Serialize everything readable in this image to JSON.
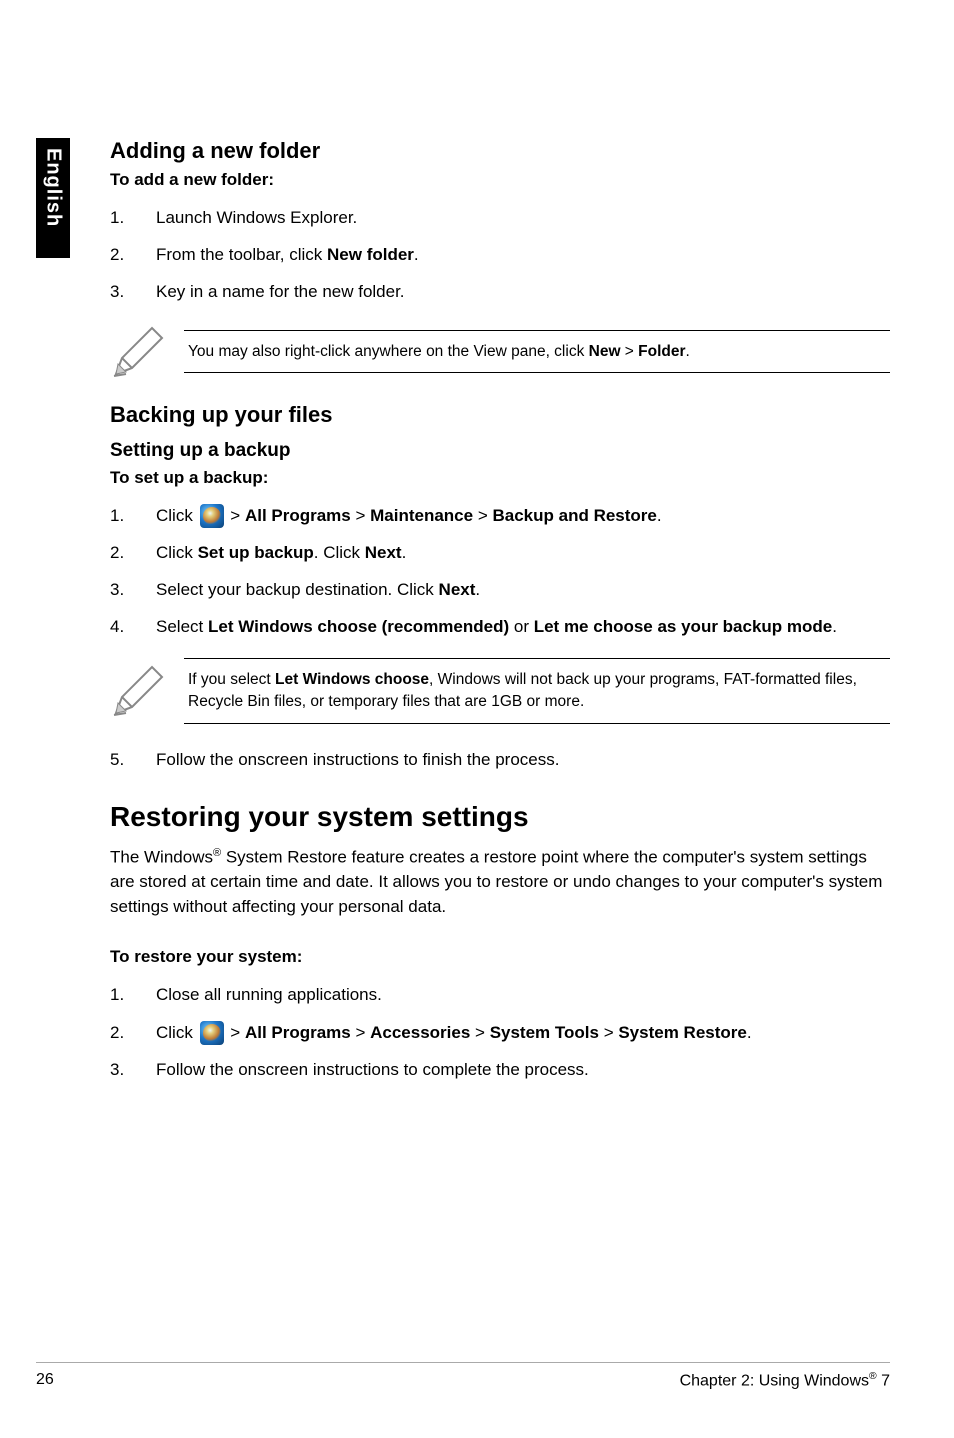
{
  "sideTab": {
    "label": "English"
  },
  "section1": {
    "heading": "Adding a new folder",
    "lead": "To add a new folder:",
    "steps": [
      {
        "text": "Launch Windows Explorer."
      },
      {
        "pre": "From the toolbar, click ",
        "b1": "New folder",
        "post": "."
      },
      {
        "text": "Key in a name for the new folder."
      }
    ],
    "note": {
      "pre": "You may also right-click anywhere on the View pane, click ",
      "b1": "New",
      "mid": " > ",
      "b2": "Folder",
      "post": "."
    }
  },
  "section2": {
    "heading": "Backing up your files",
    "sub": "Setting up a backup",
    "lead": "To set up a backup:",
    "steps": [
      {
        "pre": "Click ",
        "after_orb": " > ",
        "b1": "All Programs",
        "s1": " > ",
        "b2": "Maintenance",
        "s2": " > ",
        "b3": "Backup and Restore",
        "post": "."
      },
      {
        "pre": "Click ",
        "b1": "Set up backup",
        "mid": ". Click ",
        "b2": "Next",
        "post": "."
      },
      {
        "pre": "Select your backup destination. Click ",
        "b1": "Next",
        "post": "."
      },
      {
        "pre": "Select ",
        "b1": "Let Windows choose (recommended)",
        "mid": " or ",
        "b2": "Let me choose as your backup mode",
        "post": "."
      }
    ],
    "note": {
      "pre": "If you select ",
      "b1": "Let Windows choose",
      "post": ", Windows will not back up your programs, FAT-formatted files, Recycle Bin files, or temporary files that are 1GB or more."
    },
    "step5": {
      "num_prefix": "5.",
      "text": "Follow the onscreen instructions to finish the process."
    }
  },
  "section3": {
    "heading": "Restoring your system settings",
    "body": {
      "pre": "The Windows",
      "sup": "®",
      "post": " System Restore feature creates a restore point where the computer's system settings are stored at certain time and date. It allows you to restore or undo changes to your computer's system settings without affecting your personal data."
    },
    "lead": "To restore your system:",
    "steps": [
      {
        "text": "Close all running applications."
      },
      {
        "pre": "Click ",
        "after_orb": " > ",
        "b1": "All Programs",
        "s1": " > ",
        "b2": "Accessories",
        "s2": " > ",
        "b3": "System Tools",
        "s3": " > ",
        "b4": "System Restore",
        "post": "."
      },
      {
        "text": "Follow the onscreen instructions to complete the process."
      }
    ]
  },
  "footer": {
    "pageNum": "26",
    "chapterPre": "Chapter 2: Using Windows",
    "sup": "®",
    "chapterPost": " 7"
  }
}
